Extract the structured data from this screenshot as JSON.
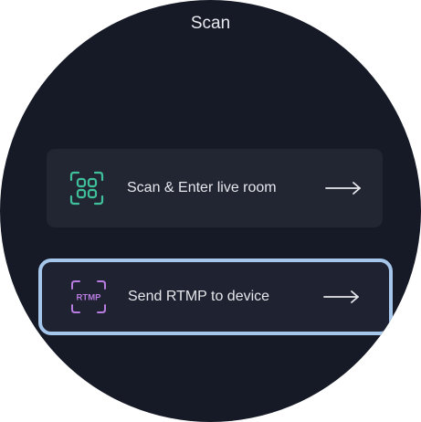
{
  "header": {
    "title": "Scan"
  },
  "menu": {
    "items": [
      {
        "label": "Scan & Enter live room",
        "icon": "qr-scan-icon",
        "icon_color": "#3fbf9a"
      },
      {
        "label": "Send RTMP to device",
        "icon": "rtmp-scan-icon",
        "icon_color": "#b87be0",
        "icon_text": "RTMP",
        "selected": true
      }
    ]
  },
  "colors": {
    "background": "#161a26",
    "card": "#222633",
    "focus_ring": "#a6c7ec",
    "text": "#e6e7ec"
  }
}
